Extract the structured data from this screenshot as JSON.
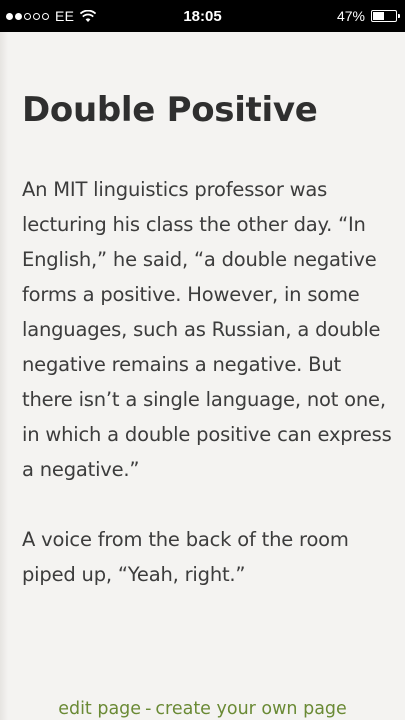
{
  "status_bar": {
    "carrier": "EE",
    "time": "18:05",
    "battery_percent": "47%",
    "battery_level": 0.47,
    "signal_filled": 2,
    "signal_total": 5
  },
  "article": {
    "title": "Double Positive",
    "paragraphs": [
      "An MIT linguistics professor was lecturing his class the other day. “In English,” he said, “a double negative forms a positive. However, in some languages, such as Russian, a double negative remains a negative. But there isn’t a single language, not one, in which a double positive can express a negative.”",
      "A voice from the back of the room piped up, “Yeah, right.”"
    ]
  },
  "footer": {
    "edit_label": "edit page",
    "separator": "-",
    "create_label": "create your own page",
    "link_color": "#6a8a35"
  }
}
